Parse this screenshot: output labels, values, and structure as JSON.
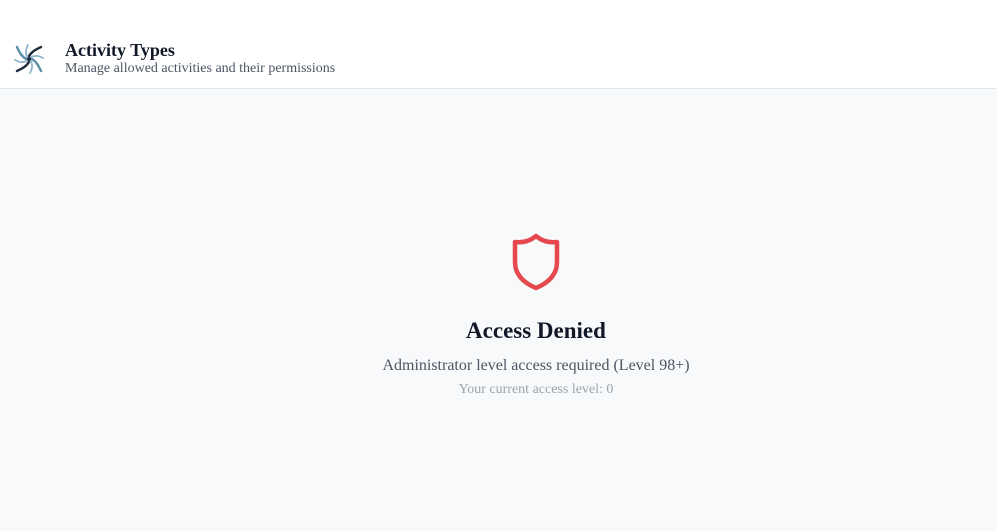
{
  "header": {
    "logo_icon": "swirl-logo-icon",
    "title": "Activity Types",
    "subtitle": "Manage allowed activities and their permissions"
  },
  "access_denied": {
    "icon": "shield-icon",
    "icon_color": "#e5484d",
    "title": "Access Denied",
    "message": "Administrator level access required (Level 98+)",
    "current_level": "Your current access level: 0"
  }
}
